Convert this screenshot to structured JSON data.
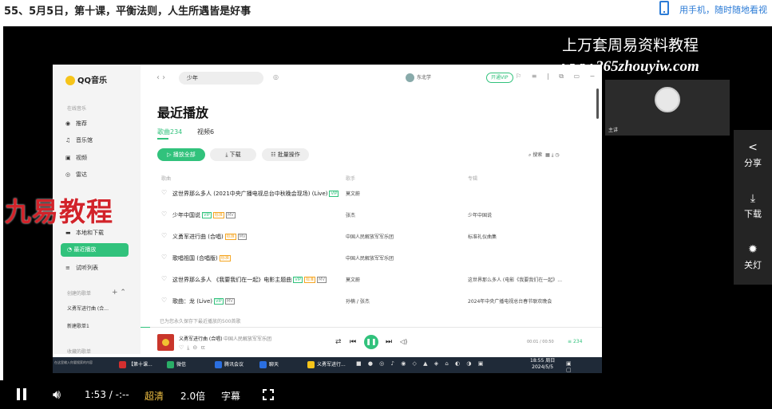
{
  "page": {
    "lesson_title": "55、5月5日，第十课，平衡法则，人生所遇皆是好事",
    "phone_text": "用手机，随时随地看视"
  },
  "watermark": {
    "title": "上万套周易资料教程",
    "url": "www.265zhouyiw.com",
    "brand": "九易教程"
  },
  "camera": {
    "name": "主讲"
  },
  "side_panel": [
    {
      "icon": "share-icon",
      "label": "分享"
    },
    {
      "icon": "download-icon",
      "label": "下载"
    },
    {
      "icon": "light-icon",
      "label": "关灯"
    }
  ],
  "app": {
    "logo": "QQ音乐",
    "sidebar": {
      "online_caption": "在线音乐",
      "online": [
        {
          "icon": "recommend-icon",
          "label": "推荐"
        },
        {
          "icon": "music-hall-icon",
          "label": "音乐馆"
        },
        {
          "icon": "video-icon",
          "label": "视频"
        },
        {
          "icon": "radio-icon",
          "label": "雷达"
        }
      ],
      "my": [
        {
          "icon": "local-download-icon",
          "label": "本地和下载"
        },
        {
          "icon": "recent-icon",
          "label": "最近播放"
        },
        {
          "icon": "trial-list-icon",
          "label": "试听列表"
        }
      ],
      "created_caption": "创建的歌单",
      "playlists": [
        "义勇军进行曲 (合...",
        "新建歌单1"
      ],
      "collected_caption": "收藏的歌单"
    },
    "header": {
      "search_value": "少年",
      "user_name": "东北学",
      "vip_label": "开通VIP"
    },
    "main": {
      "title": "最近播放",
      "tabs": [
        "歌曲234",
        "视频6"
      ],
      "buttons": {
        "play_all": "播放全部",
        "download": "下载",
        "batch": "批量操作"
      },
      "search_label": "搜索",
      "columns": [
        "歌曲",
        "歌手",
        "专辑"
      ],
      "songs": [
        {
          "title": "这世界那么多人 (2021中央广播电视总台中秋晚会现场) (Live)",
          "tags": [
            "VIP"
          ],
          "artist": "莫文蔚",
          "album": ""
        },
        {
          "title": "少年中国说",
          "tags": [
            "VIP",
            "标准",
            "MV"
          ],
          "artist": "张杰",
          "album": "少年中国说"
        },
        {
          "title": "义勇军进行曲 (合唱)",
          "tags": [
            "标准",
            "MV"
          ],
          "artist": "中国人民解放军军乐团",
          "album": "标准礼仪曲集"
        },
        {
          "title": "歌唱祖国 (合唱版)",
          "tags": [
            "标准"
          ],
          "artist": "中国人民解放军军乐团",
          "album": ""
        },
        {
          "title": "这世界那么多人 《我要我们在一起》电影主题曲",
          "tags": [
            "VIP",
            "标准",
            "MV"
          ],
          "artist": "莫文蔚",
          "album": "这世界那么多人 (电影《我要我们在一起》..."
        },
        {
          "title": "歌曲：龙 (Live)",
          "tags": [
            "VIP",
            "MV"
          ],
          "artist": "孙楠 / 张杰",
          "album": "2024年中央广播电视总台春节联欢晚会"
        }
      ],
      "footnote": "已为您永久保存下最近播放的500首歌"
    },
    "player": {
      "song": "义勇军进行曲 (合唱)",
      "artist": "中国人民解放军军乐团",
      "time": "00:01 / 00:50",
      "progress": 0.02,
      "list_count": "234",
      "quality": "标准"
    }
  },
  "taskbar": {
    "search_hint": "在这里输入你要搜索的内容",
    "items": [
      {
        "label": "【第十课...",
        "color": "#d32f2f"
      },
      {
        "label": "微信",
        "color": "#2aae67"
      },
      {
        "label": "腾讯会议",
        "color": "#2b6fe0"
      },
      {
        "label": "聊天",
        "color": "#2b6fe0"
      },
      {
        "label": "义勇军进行...",
        "color": "#f6c41a"
      }
    ],
    "time": "18:55 周日",
    "date": "2024/5/5"
  },
  "controls": {
    "time": "1:53 / -:--",
    "quality": "超清",
    "rate": "2.0倍",
    "subtitle": "字幕"
  }
}
